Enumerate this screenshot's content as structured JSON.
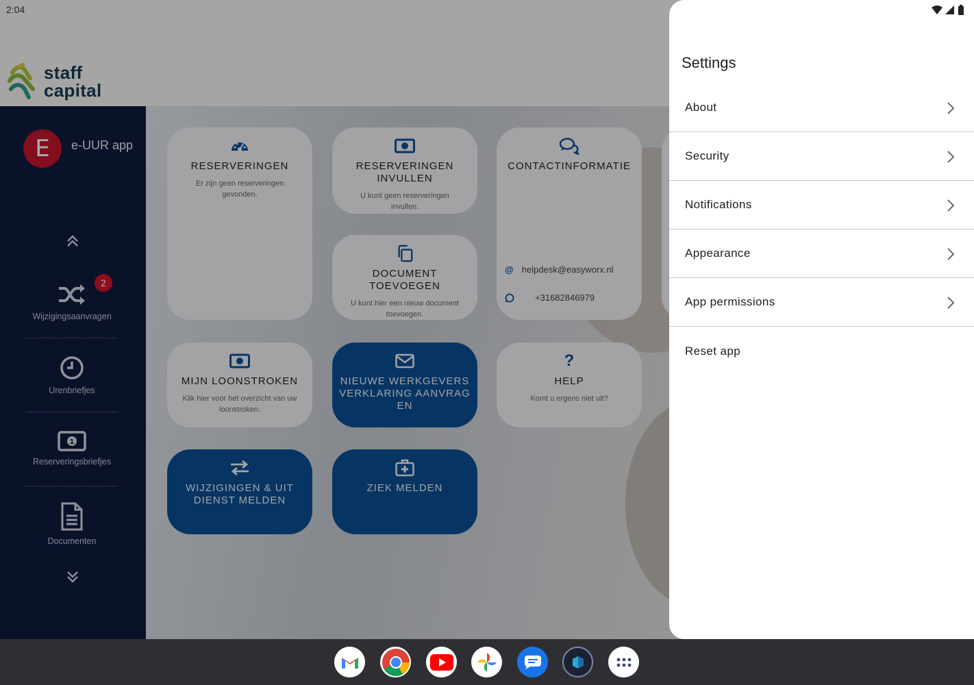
{
  "status_bar": {
    "time": "2:04"
  },
  "header": {
    "brand_line1": "staff",
    "brand_line2": "capital"
  },
  "sidebar": {
    "avatar_letter": "E",
    "app_name": "e-UUR app",
    "badge_count": "2",
    "items": [
      {
        "label": "Wijzigingsaanvragen",
        "icon": "shuffle-icon"
      },
      {
        "label": "Urenbriefjes",
        "icon": "clock-icon"
      },
      {
        "label": "Reserveringsbriefjes",
        "icon": "money-icon"
      },
      {
        "label": "Documenten",
        "icon": "document-icon"
      }
    ]
  },
  "cards": {
    "reserveringen": {
      "title": "RESERVERINGEN",
      "subtitle": "Er zijn geen reserveringen gevonden."
    },
    "reserveringen_invullen": {
      "title": "RESERVERINGEN INVULLEN",
      "subtitle": "U kunt geen reserveringen invullen."
    },
    "contactinformatie": {
      "title": "CONTACTINFORMATIE",
      "email": "helpdesk@easyworx.nl",
      "phone": "+31682846979"
    },
    "document_toevoegen": {
      "title": "DOCUMENT TOEVOEGEN",
      "subtitle": "U kunt hier een nieuw document toevoegen."
    },
    "mijn_loonstroken": {
      "title": "MIJN LOONSTROKEN",
      "subtitle": "Klik hier voor het overzicht van uw loonstroken."
    },
    "nieuwe_werkgeversverklaring": {
      "title": "NIEUWE WERKGEVERSVERKLARING AANVRAGEN"
    },
    "help": {
      "title": "HELP",
      "subtitle": "Komt u ergens niet uit?"
    },
    "wijzigingen": {
      "title": "WIJZIGINGEN & UIT DIENST MELDEN"
    },
    "ziek_melden": {
      "title": "ZIEK MELDEN"
    }
  },
  "settings": {
    "title": "Settings",
    "items": [
      {
        "label": "About",
        "has_chevron": true
      },
      {
        "label": "Security",
        "has_chevron": true
      },
      {
        "label": "Notifications",
        "has_chevron": true
      },
      {
        "label": "Appearance",
        "has_chevron": true
      },
      {
        "label": "App permissions",
        "has_chevron": true
      },
      {
        "label": "Reset app",
        "has_chevron": false
      }
    ]
  },
  "taskbar": {
    "apps": [
      "gmail-icon",
      "chrome-icon",
      "youtube-icon",
      "photos-icon",
      "messages-icon",
      "easyworx-icon",
      "app-drawer-icon"
    ]
  },
  "colors": {
    "sidebar_bg": "#0f1b3f",
    "card_dark": "#0b4f94",
    "badge": "#d2142d",
    "avatar": "#c4162a"
  }
}
